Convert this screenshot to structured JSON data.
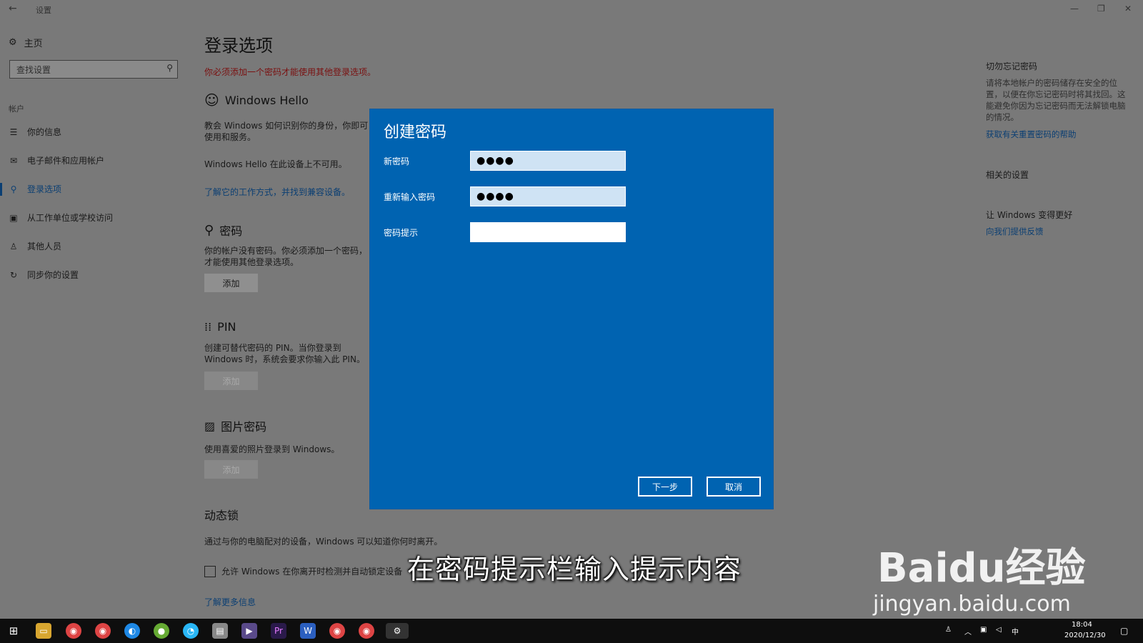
{
  "window": {
    "title": "设置",
    "back_glyph": "←",
    "minimize_glyph": "—",
    "restore_glyph": "❐",
    "close_glyph": "✕"
  },
  "sidebar": {
    "home_label": "主页",
    "search_placeholder": "查找设置",
    "section_label": "帐户",
    "items": [
      {
        "label": "你的信息",
        "icon": "person-list-icon",
        "glyph": "☰"
      },
      {
        "label": "电子邮件和应用帐户",
        "icon": "mail-icon",
        "glyph": "✉"
      },
      {
        "label": "登录选项",
        "icon": "key-icon",
        "glyph": "⚲",
        "active": true
      },
      {
        "label": "从工作单位或学校访问",
        "icon": "briefcase-icon",
        "glyph": "▣"
      },
      {
        "label": "其他人员",
        "icon": "person-icon",
        "glyph": "♙"
      },
      {
        "label": "同步你的设置",
        "icon": "sync-icon",
        "glyph": "↻"
      }
    ]
  },
  "main": {
    "title": "登录选项",
    "warning": "你必须添加一个密码才能使用其他登录选项。",
    "hello": {
      "heading": "Windows Hello",
      "desc": "教会 Windows 如何识别你的身份，你即可使用和服务。",
      "unavailable": "Windows Hello 在此设备上不可用。",
      "link": "了解它的工作方式，并找到兼容设备。"
    },
    "password": {
      "heading": "密码",
      "desc": "你的帐户没有密码。你必须添加一个密码，才能使用其他登录选项。",
      "button": "添加"
    },
    "pin": {
      "heading": "PIN",
      "desc": "创建可替代密码的 PIN。当你登录到 Windows 时，系统会要求你输入此 PIN。",
      "button": "添加"
    },
    "picture": {
      "heading": "图片密码",
      "desc": "使用喜爱的照片登录到 Windows。",
      "button": "添加"
    },
    "dynamic_lock": {
      "heading": "动态锁",
      "desc": "通过与你的电脑配对的设备，Windows 可以知道你何时离开。",
      "checkbox_label": "允许 Windows 在你离开时检测并自动锁定设备",
      "link": "了解更多信息"
    }
  },
  "right_panel": {
    "forget_heading": "切勿忘记密码",
    "forget_text": "请将本地帐户的密码储存在安全的位置，以便在你忘记密码时将其找回。这能避免你因为忘记密码而无法解锁电脑的情况。",
    "forget_link": "获取有关重置密码的帮助",
    "related_heading": "相关的设置",
    "better_heading": "让 Windows 变得更好",
    "better_link": "向我们提供反馈"
  },
  "dialog": {
    "title": "创建密码",
    "new_password_label": "新密码",
    "new_password_value": "●●●●",
    "reenter_label": "重新输入密码",
    "reenter_value": "●●●●",
    "hint_label": "密码提示",
    "hint_value": "",
    "next_button": "下一步",
    "cancel_button": "取消"
  },
  "caption": "在密码提示栏输入提示内容",
  "watermark": {
    "brand": "Baidu经验",
    "url": "jingyan.baidu.com"
  },
  "taskbar": {
    "time": "18:04",
    "date": "2020/12/30",
    "ime": "中"
  }
}
